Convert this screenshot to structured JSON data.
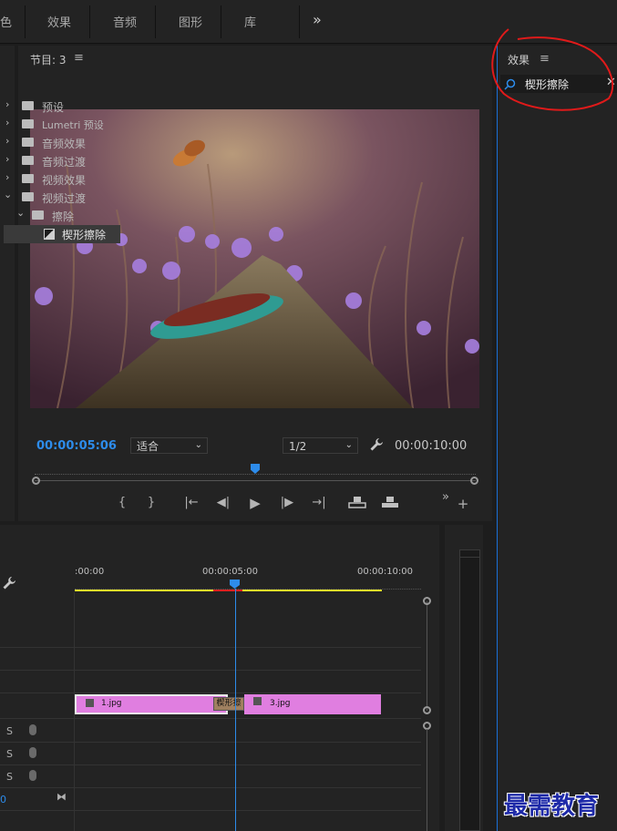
{
  "menu": {
    "items": [
      "色",
      "效果",
      "音频",
      "图形",
      "库"
    ],
    "overflow": "»"
  },
  "monitor": {
    "title": "节目: 3",
    "menu_icon": "≡",
    "timecode_current": "00:00:05:06",
    "zoom": "适合",
    "resolution": "1/2",
    "timecode_total": "00:00:10:00",
    "playhead_fraction": 0.5
  },
  "effects": {
    "title": "效果",
    "menu_icon": "≡",
    "search_value": "楔形擦除",
    "tree": [
      {
        "label": "预设",
        "kind": "preset"
      },
      {
        "label": "Lumetri 预设",
        "kind": "preset"
      },
      {
        "label": "音频效果",
        "kind": "folder"
      },
      {
        "label": "音频过渡",
        "kind": "folder"
      },
      {
        "label": "视频效果",
        "kind": "folder"
      },
      {
        "label": "视频过渡",
        "kind": "folder",
        "expanded": true
      },
      {
        "label": "擦除",
        "kind": "folder",
        "expanded": true
      },
      {
        "label": "楔形擦除",
        "kind": "effect",
        "selected": true
      }
    ]
  },
  "timeline": {
    "ruler": [
      ":00:00",
      "00:00:05:00",
      "00:00:10:00"
    ],
    "clips": [
      {
        "label": "1.jpg"
      },
      {
        "label": "楔形擦"
      },
      {
        "label": "3.jpg"
      }
    ],
    "track_letters": [
      "S",
      "S",
      "S"
    ],
    "track_zero": "0"
  },
  "watermark": "最需教育",
  "colors": {
    "accent": "#2d8ceb",
    "clip": "#e07ee0",
    "annotation": "#e01a1a",
    "workarea": "#e6e62a"
  }
}
